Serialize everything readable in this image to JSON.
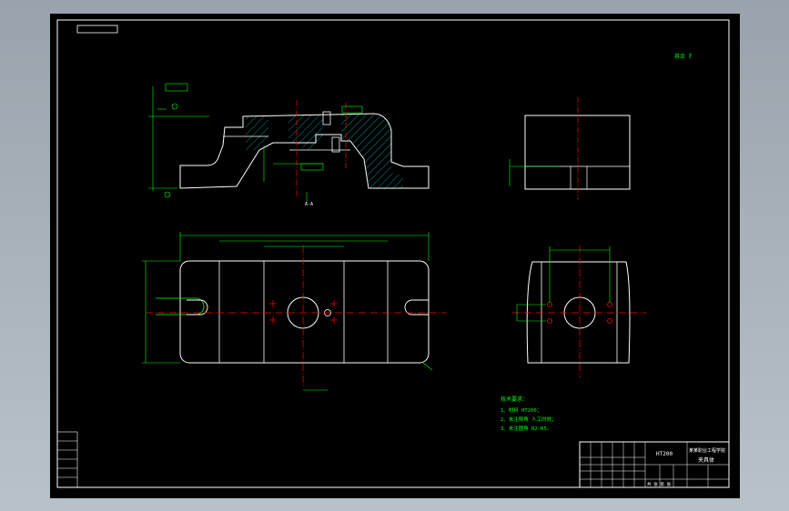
{
  "drawing": {
    "roughness_note": "其余 ∛",
    "section_label": "A-A",
    "tech_requirements": {
      "title": "技术要求：",
      "items": [
        "1、材料 HT200；",
        "2、未注倒角 人工时效；",
        "3、未注圆角 R2~R5。"
      ]
    },
    "title_block": {
      "material": "HT200",
      "school": "某某职业工程学院",
      "part_name": "夹具体",
      "scale": "比例",
      "sheet": "共 张 第 张"
    },
    "dimensions": {
      "top_width": "330",
      "inner_width": "260",
      "hole_pitch": "120",
      "slot_width": "40",
      "side_width": "120",
      "height_mark": "60"
    }
  },
  "colors": {
    "background": "#000000",
    "outline": "#ffffff",
    "dimension": "#00ff00",
    "centerline": "#ff0000",
    "hatch": "#00c8c8",
    "window": "#a3acb5"
  }
}
